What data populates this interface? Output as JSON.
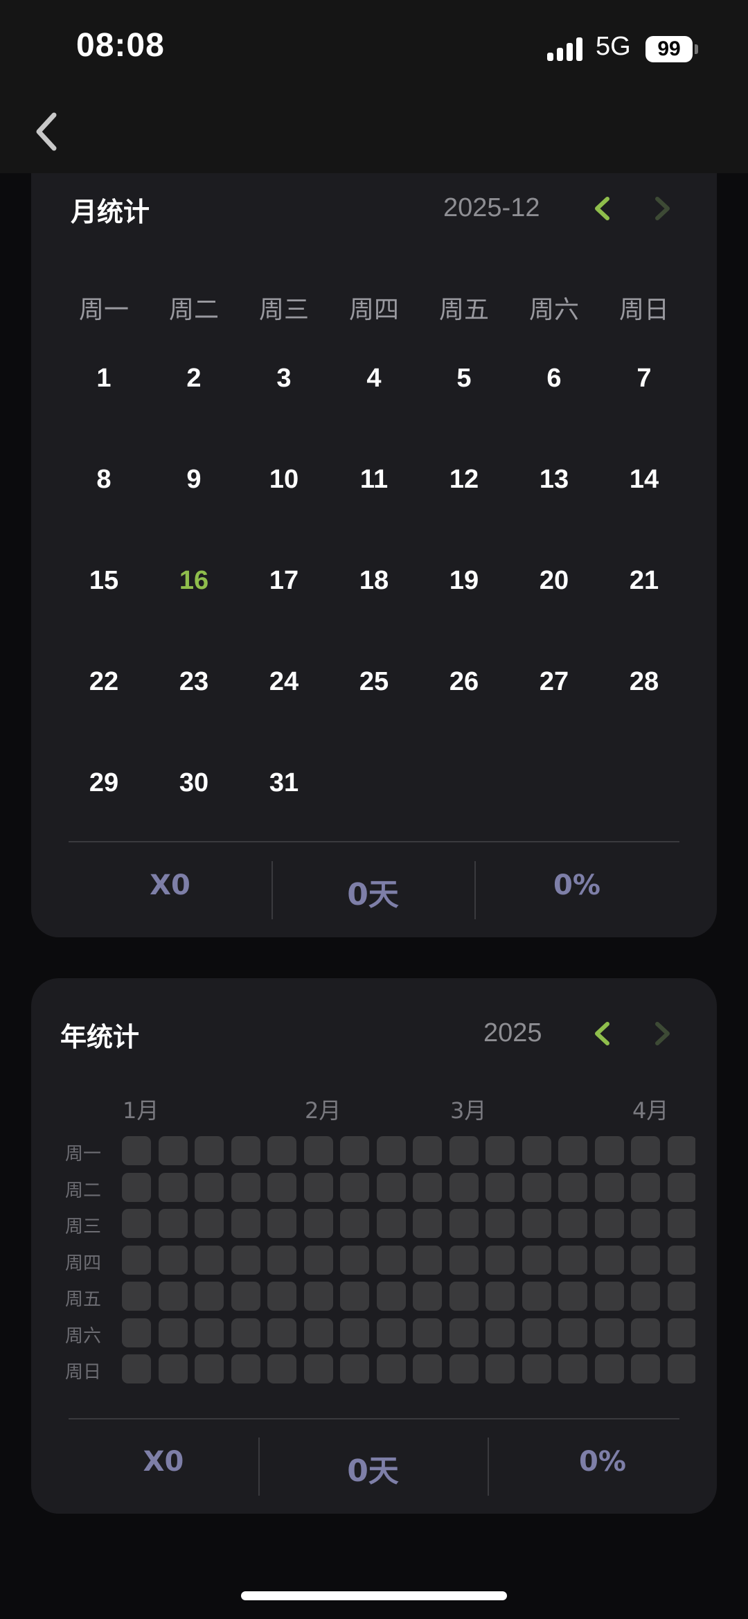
{
  "status_bar": {
    "time": "08:08",
    "network": "5G",
    "battery": "99"
  },
  "month_stats": {
    "title": "月统计",
    "period": "2025-12",
    "weekdays": [
      "周一",
      "周二",
      "周三",
      "周四",
      "周五",
      "周六",
      "周日"
    ],
    "days": [
      "1",
      "2",
      "3",
      "4",
      "5",
      "6",
      "7",
      "8",
      "9",
      "10",
      "11",
      "12",
      "13",
      "14",
      "15",
      "16",
      "17",
      "18",
      "19",
      "20",
      "21",
      "22",
      "23",
      "24",
      "25",
      "26",
      "27",
      "28",
      "29",
      "30",
      "31"
    ],
    "today": "16",
    "summary": [
      "X0",
      "0天",
      "0%"
    ]
  },
  "year_stats": {
    "title": "年统计",
    "period": "2025",
    "month_labels": [
      "1月",
      "2月",
      "3月",
      "4月"
    ],
    "row_labels": [
      "周一",
      "周二",
      "周三",
      "周四",
      "周五",
      "周六",
      "周日"
    ],
    "summary": [
      "X0",
      "0天",
      "0%"
    ]
  },
  "colors": {
    "accent": "#8fbe4c",
    "arrow_disabled": "#3d4a35",
    "stat_text": "#7e7fa8",
    "heat_empty": "#3a3a3c",
    "card_bg": "#1c1c20"
  },
  "icons": {
    "back": "chevron-left-icon",
    "prev": "chevron-left-icon",
    "next": "chevron-right-icon"
  }
}
